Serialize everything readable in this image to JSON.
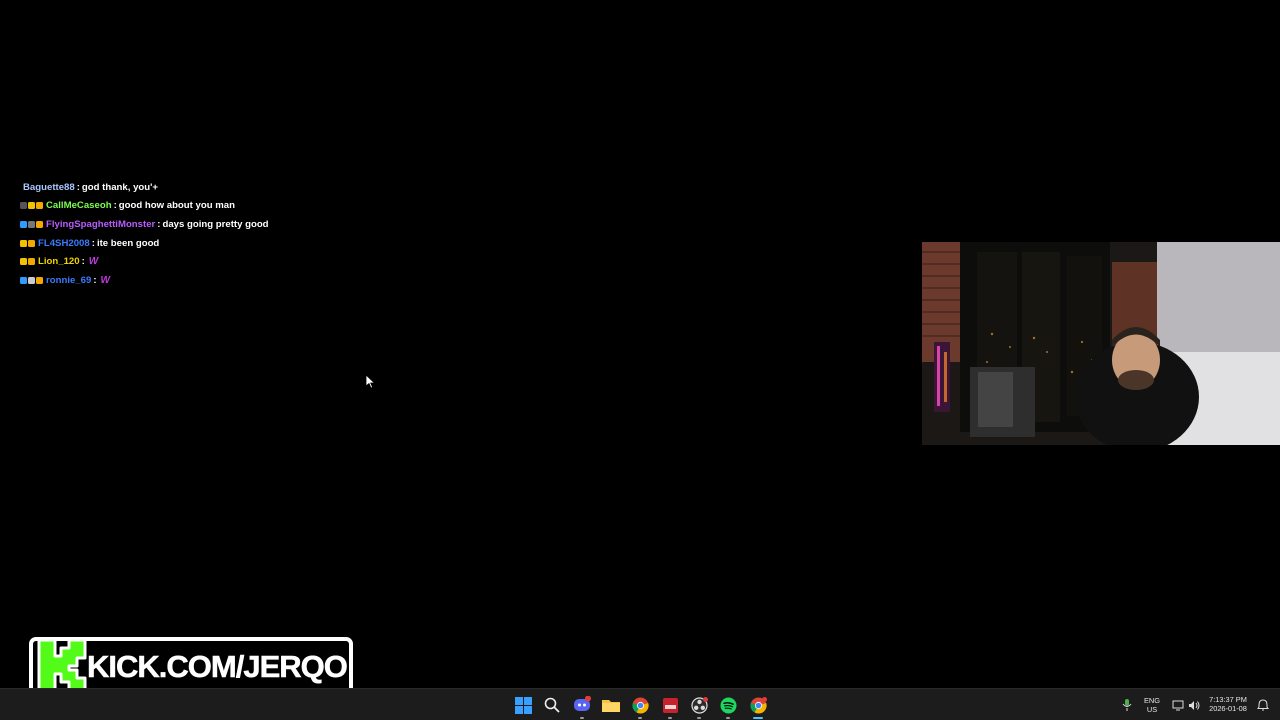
{
  "chat": {
    "messages": [
      {
        "user": "Baguette88",
        "user_color": "#a9c6ff",
        "text": "god thank, you'+",
        "badges": []
      },
      {
        "user": "CallMeCaseoh",
        "user_color": "#7cff4f",
        "text": "good how about you man",
        "badges": [
          "#555555",
          "#f2c200",
          "#f2a900"
        ]
      },
      {
        "user": "FlyingSpaghettiMonster",
        "user_color": "#b95cff",
        "text": "days going pretty good",
        "badges": [
          "#2f9bff",
          "#777777",
          "#f2a900"
        ]
      },
      {
        "user": "FL4SH2008",
        "user_color": "#3a7bff",
        "text": "ite been good",
        "badges": [
          "#f2c200",
          "#f2a900"
        ]
      },
      {
        "user": "Lion_120",
        "user_color": "#f2d200",
        "text": "",
        "emote": "W",
        "badges": [
          "#f2c200",
          "#f2a900"
        ]
      },
      {
        "user": "ronnie_69",
        "user_color": "#3a7bff",
        "text": "",
        "emote": "W",
        "badges": [
          "#2f9bff",
          "#cccccc",
          "#f2a900"
        ]
      }
    ]
  },
  "banner": {
    "logo_letter": "K",
    "url": "KICK.COM/JERQO",
    "accent": "#53fc18"
  },
  "taskbar": {
    "apps": [
      {
        "name": "start",
        "icon": "windows-icon"
      },
      {
        "name": "search",
        "icon": "search-icon"
      },
      {
        "name": "discord",
        "icon": "discord-icon",
        "badge": "9+"
      },
      {
        "name": "file-explorer",
        "icon": "folder-icon"
      },
      {
        "name": "chrome",
        "icon": "chrome-icon"
      },
      {
        "name": "tool",
        "icon": "app-icon"
      },
      {
        "name": "obs",
        "icon": "obs-icon"
      },
      {
        "name": "spotify",
        "icon": "spotify-icon"
      },
      {
        "name": "chrome-profile",
        "icon": "chrome-icon",
        "badge": "2"
      }
    ],
    "tray": {
      "lang_line1": "ENG",
      "lang_line2": "US",
      "time": "7:13:37 PM",
      "date": "2026-01-08"
    }
  }
}
